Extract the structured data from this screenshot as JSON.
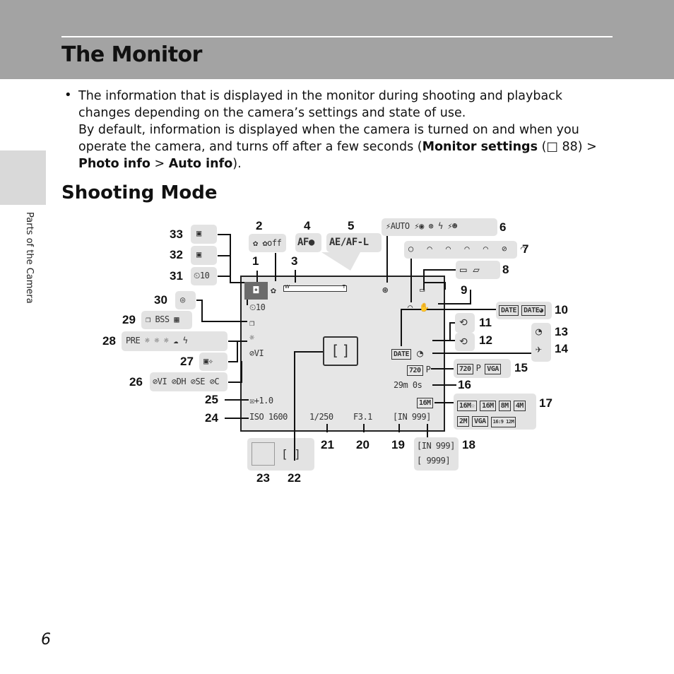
{
  "header": {
    "title": "The Monitor"
  },
  "side_label": "Parts of the Camera",
  "bullet": {
    "line1": "The information that is displayed in the monitor during shooting and playback changes depending on the camera’s settings and state of use.",
    "line2a": "By default, information is displayed when the camera is turned on and when you operate the camera, and turns off after a few seconds (",
    "bold1": "Monitor settings",
    "ref": " (□ 88) > ",
    "bold2": "Photo info",
    "gt": " > ",
    "bold3": "Auto info",
    "end": ")."
  },
  "section_title": "Shooting Mode",
  "page_number": "6",
  "callouts": [
    "1",
    "2",
    "3",
    "4",
    "5",
    "6",
    "7",
    "8",
    "9",
    "10",
    "11",
    "12",
    "13",
    "14",
    "15",
    "16",
    "17",
    "18",
    "19",
    "20",
    "21",
    "22",
    "23",
    "24",
    "25",
    "26",
    "27",
    "28",
    "29",
    "30",
    "31",
    "32",
    "33"
  ],
  "icons": {
    "c2": "✿ ✿off",
    "c4": "AF●",
    "c5": "AE/AF-L",
    "c6": "⚡AUTO ⚡◉ ⊛ ϟ ⚡☻",
    "c7": "○ ◠ ◠ ◠ ◠ ⊘ ◠",
    "c8": "▭ ▱",
    "c10a": "DATE",
    "c10b": "DATE◕",
    "c11": "⟲",
    "c12": "⟲",
    "c13": "◔",
    "c14": "✈",
    "c15a": "720",
    "c15b": "P",
    "c15c": "VGA",
    "c17": [
      "16M☆",
      "16M",
      "8M",
      "4M",
      "2M",
      "VGA",
      "16:9 12M"
    ],
    "c18a": "[IN 999]",
    "c18b": "[ 9999]",
    "c22": "[    ]",
    "c26": "⊘VI ⊘DH ⊘SE ⊘C",
    "c27": "▣✧",
    "c28": "PRE ☼ ☼ ☼ ☁ ϟ",
    "c29": "❐ BSS ▦",
    "c30": "◎",
    "c31": "⏲10",
    "c32": "▣",
    "c33": "▣"
  },
  "monitor": {
    "shooting_mode": "◘",
    "macro": "✿",
    "zoom_w": "W",
    "zoom_t": "T",
    "flash": "⊛",
    "battery": "▭",
    "wifi": "◠",
    "vr": "✋",
    "self_timer": "⏲10",
    "continuous": "❐",
    "wb": "☼",
    "color": "⊘VI",
    "exposure": "☒+1.0",
    "iso": "ISO 1600",
    "shutter": "1/250",
    "aperture": "F3.1",
    "exposures": "[IN 999]",
    "date": "DATE",
    "clock": "◔",
    "movie": "720",
    "movie_p": "P",
    "movie_time": "29m 0s",
    "image_size": "16M",
    "focus": "[    ]"
  }
}
